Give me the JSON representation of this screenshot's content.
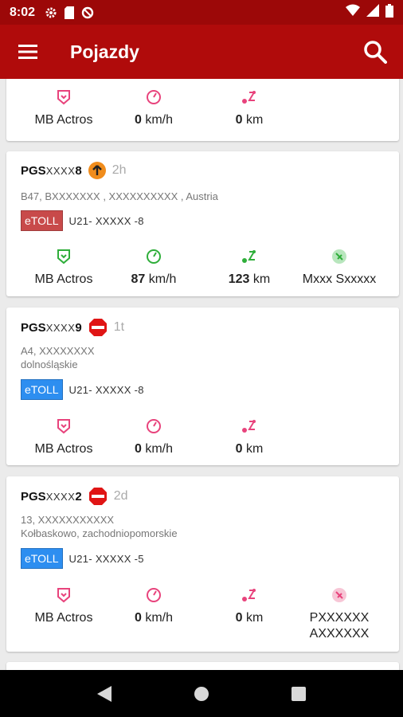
{
  "status_bar": {
    "time": "8:02"
  },
  "app_bar": {
    "title": "Pojazdy"
  },
  "colors": {
    "app_bar": "#b00b0b",
    "status_bar": "#9c0808",
    "etoll_red": "#c84a4a",
    "etoll_blue": "#2d8ef0",
    "stat_pink": "#e8437c",
    "stat_green": "#2fae3a"
  },
  "vehicles": [
    {
      "stats": {
        "model": "MB Actros",
        "speed_value": "0",
        "speed_unit": "km/h",
        "distance_value": "0",
        "distance_unit": "km"
      }
    },
    {
      "plate_prefix": "PGS",
      "plate_mid": "XXXX",
      "plate_suffix": "8",
      "status_icon": "arrow-up-icon",
      "age": "2h",
      "address_line1": "B47, BXXXXXXX , XXXXXXXXXX , Austria",
      "etoll_label": "eTOLL",
      "etoll_color": "#c84a4a",
      "toll_id": "U21- XXXXX -8",
      "stats": {
        "model": "MB Actros",
        "speed_value": "87",
        "speed_unit": "km/h",
        "distance_value": "123",
        "distance_unit": "km",
        "driver_line1": "Mxxx  Sxxxxx"
      }
    },
    {
      "plate_prefix": "PGS",
      "plate_mid": "XXXX",
      "plate_suffix": "9",
      "status_icon": "stop-sign-icon",
      "age": "1t",
      "address_line1": "A4, XXXXXXXX",
      "address_line2": "dolnośląskie",
      "etoll_label": "eTOLL",
      "etoll_color": "#2d8ef0",
      "toll_id": "U21- XXXXX -8",
      "stats": {
        "model": "MB Actros",
        "speed_value": "0",
        "speed_unit": "km/h",
        "distance_value": "0",
        "distance_unit": "km"
      }
    },
    {
      "plate_prefix": "PGS",
      "plate_mid": "XXXX",
      "plate_suffix": "2",
      "status_icon": "stop-sign-icon",
      "age": "2d",
      "address_line1": "13, XXXXXXXXXXX",
      "address_line2": "Kołbaskowo, zachodniopomorskie",
      "etoll_label": "eTOLL",
      "etoll_color": "#2d8ef0",
      "toll_id": "U21- XXXXX -5",
      "stats": {
        "model": "MB Actros",
        "speed_value": "0",
        "speed_unit": "km/h",
        "distance_value": "0",
        "distance_unit": "km",
        "driver_line1": "PXXXXXX",
        "driver_line2": "AXXXXXX"
      }
    }
  ]
}
